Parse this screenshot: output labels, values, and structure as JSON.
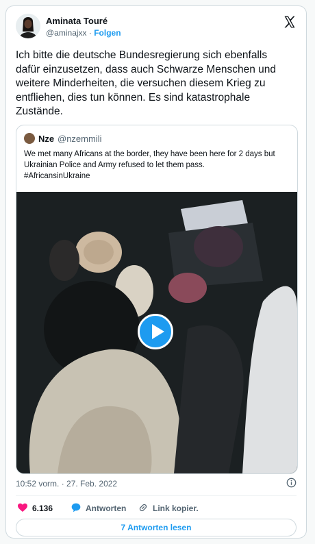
{
  "author": {
    "name": "Aminata Touré",
    "handle": "@aminajxx",
    "follow_label": "Folgen"
  },
  "tweet": {
    "text": "Ich bitte die deutsche Bundesregierung sich ebenfalls\ndafür einzusetzen, dass auch Schwarze Menschen und\nweitere Minderheiten, die versuchen diesem Krieg zu\nentfliehen, dies tun können. Es sind katastrophale\nZustände.",
    "timestamp": "10:52 vorm. · 27. Feb. 2022"
  },
  "quoted": {
    "name": "Nze",
    "handle": "@nzemmili",
    "text": "We met many Africans at the border, they have been here for 2 days but\nUkrainian Police and Army refused to let them pass.\n#AfricansinUkraine"
  },
  "actions": {
    "likes": "6.136",
    "reply_label": "Antworten",
    "copy_label": "Link kopier."
  },
  "replies_button": "7 Antworten lesen",
  "icons": {
    "brand": "x-logo",
    "like": "heart-icon",
    "reply": "reply-bubble-icon",
    "copy": "link-icon",
    "info": "info-icon",
    "play": "play-icon"
  },
  "colors": {
    "accent": "#1d9bf0",
    "like": "#f91880",
    "muted": "#536471"
  }
}
